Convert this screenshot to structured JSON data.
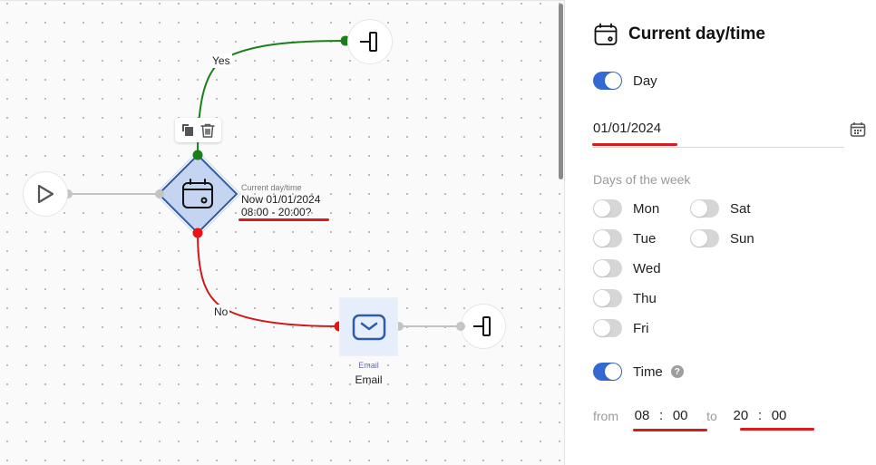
{
  "canvas": {
    "edges": {
      "yes_label": "Yes",
      "no_label": "No",
      "yes_color": "#1a7f1a",
      "no_color": "#d01818",
      "neutral_color": "#c2c2c2"
    },
    "nodes": {
      "start": {
        "icon": "play-icon"
      },
      "condition": {
        "icon": "calendar-icon",
        "type_label": "Current day/time",
        "line1": "Now 01/01/2024",
        "line2": "08:00 - 20:00?"
      },
      "email": {
        "icon": "mail-icon",
        "type_label": "Email",
        "name": "Email"
      },
      "exit_yes": {
        "icon": "exit-icon"
      },
      "exit_no": {
        "icon": "exit-icon"
      }
    },
    "toolbar": {
      "copy": "copy-icon",
      "delete": "trash-icon"
    }
  },
  "panel": {
    "title": "Current day/time",
    "day_toggle": {
      "label": "Day",
      "on": true
    },
    "date": {
      "value": "01/01/2024"
    },
    "days_section": "Days of the week",
    "days": [
      {
        "label": "Mon",
        "on": false
      },
      {
        "label": "Tue",
        "on": false
      },
      {
        "label": "Wed",
        "on": false
      },
      {
        "label": "Thu",
        "on": false
      },
      {
        "label": "Fri",
        "on": false
      },
      {
        "label": "Sat",
        "on": false
      },
      {
        "label": "Sun",
        "on": false
      }
    ],
    "time_toggle": {
      "label": "Time",
      "on": true,
      "help": "?"
    },
    "time": {
      "from_label": "from",
      "to_label": "to",
      "separator": ":",
      "from_hour": "08",
      "from_min": "00",
      "to_hour": "20",
      "to_min": "00"
    }
  },
  "colors": {
    "accent": "#3269d2",
    "highlight": "#d81b1b"
  }
}
